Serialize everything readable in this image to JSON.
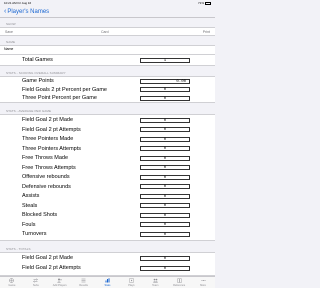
{
  "status": {
    "time": "10:21 AM",
    "date": "Fri Aug 16",
    "battery": "71%"
  },
  "nav": {
    "back_label": "Player's Names"
  },
  "sections": {
    "show": "SHOW",
    "name": "NAME",
    "scoring": "STATS - SCORING OVERALL SUMMARY",
    "averages": "STATS - AVERAGE PER GAME",
    "totals": "STATS - TOTALS"
  },
  "show_bar": {
    "save": "Save",
    "card": "Card",
    "print": "Print"
  },
  "name_value": "Name",
  "total_games": {
    "label": "Total Games",
    "value": "1"
  },
  "scoring_rows": [
    {
      "label": "Game Points",
      "value": "0.00"
    },
    {
      "label": "Field Goals 2 pt Percent per Game",
      "value": "0"
    },
    {
      "label": "Three Point Percent per Game",
      "value": "0"
    }
  ],
  "average_rows": [
    {
      "label": "Field Goal 2 pt Made",
      "value": "0"
    },
    {
      "label": "Field Goal 2 pt Attempts",
      "value": "0"
    },
    {
      "label": "Three Pointers Made",
      "value": "0"
    },
    {
      "label": "Three Pointers Attempts",
      "value": "0"
    },
    {
      "label": "Free Throws Made",
      "value": "0"
    },
    {
      "label": "Free Throws Attempts",
      "value": "0"
    },
    {
      "label": "Offensive rebounds",
      "value": "0"
    },
    {
      "label": "Defensive rebounds",
      "value": "0"
    },
    {
      "label": "Assists",
      "value": "0"
    },
    {
      "label": "Steals",
      "value": "0"
    },
    {
      "label": "Blocked Shots",
      "value": "0"
    },
    {
      "label": "Fouls",
      "value": "0"
    },
    {
      "label": "Turnovers",
      "value": "0"
    }
  ],
  "total_rows": [
    {
      "label": "Field Goal 2 pt Made",
      "value": "0"
    },
    {
      "label": "Field Goal 2 pt Attempts",
      "value": "0"
    }
  ],
  "tabs": [
    {
      "label": "Game",
      "icon": "basketball-icon"
    },
    {
      "label": "Subs",
      "icon": "swap-icon"
    },
    {
      "label": "Add Players",
      "icon": "add-person-icon"
    },
    {
      "label": "Results",
      "icon": "list-icon"
    },
    {
      "label": "Stats",
      "icon": "stats-icon"
    },
    {
      "label": "Plays",
      "icon": "play-icon"
    },
    {
      "label": "Team",
      "icon": "team-icon"
    },
    {
      "label": "Reference",
      "icon": "book-icon"
    },
    {
      "label": "More",
      "icon": "more-icon"
    }
  ],
  "active_tab": "Stats",
  "colors": {
    "accent": "#1a66d1",
    "background": "#f2f2f7"
  }
}
